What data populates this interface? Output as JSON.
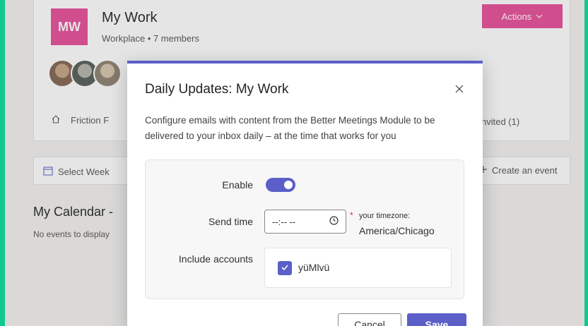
{
  "workspace": {
    "initials": "MW",
    "title": "My Work",
    "subtitle": "Workplace • 7 members",
    "actions_label": "Actions"
  },
  "nav": {
    "friction_label": "Friction F",
    "invited_label": "nvited (1)"
  },
  "toolbar": {
    "select_week_label": "Select Week",
    "create_event_label": "Create an event"
  },
  "calendar": {
    "title": "My Calendar -",
    "empty_text": "No events to display"
  },
  "modal": {
    "title": "Daily Updates: My Work",
    "description": "Configure emails with content from the Better Meetings Module to be delivered to your inbox daily – at the time that works for you",
    "enable_label": "Enable",
    "enable_state": true,
    "send_time_label": "Send time",
    "time_value": "--:-- --",
    "required_mark": "*",
    "timezone_label": "your timezone:",
    "timezone_value": "America/Chicago",
    "include_accounts_label": "Include accounts",
    "account_name": "yüMlvü",
    "account_checked": true,
    "cancel_label": "Cancel",
    "save_label": "Save"
  },
  "colors": {
    "accent": "#5b5fc7",
    "brand_pink": "#e8579f",
    "frame_green": "#11c98f"
  },
  "icons": {
    "close": "close-icon",
    "clock": "clock-icon",
    "check": "checkmark-icon",
    "home": "home-icon",
    "calendar": "calendar-icon",
    "plus": "plus-icon",
    "chevron": "chevron-down-icon"
  }
}
